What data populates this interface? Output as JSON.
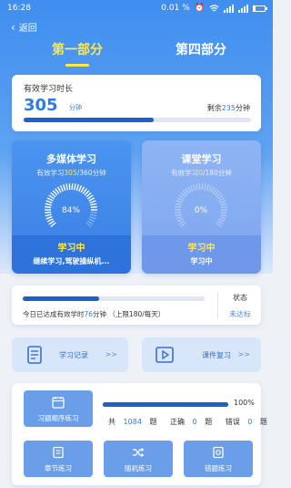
{
  "status_bar": {
    "time": "16:28",
    "data_speed": "0.01",
    "speed_unit": "%"
  },
  "nav": {
    "back_label": "返回"
  },
  "tabs": [
    {
      "label": "第一部分",
      "active": true
    },
    {
      "label": "第四部分",
      "active": false
    }
  ],
  "effective_study": {
    "title": "有效学习时长",
    "value": "305",
    "unit": "分钟",
    "remaining_prefix": "剩余",
    "remaining_value": "235",
    "remaining_unit": "分钟",
    "progress": 0.57
  },
  "multimedia": {
    "title": "多媒体学习",
    "sub_prefix": "有效学习",
    "sub_done": "305",
    "sub_total": "/360分钟",
    "percent_label": "84%",
    "percent": 84,
    "status": "学习中",
    "desc": "继续学习,驾驶操纵机..."
  },
  "classroom": {
    "title": "课堂学习",
    "sub_prefix": "有效学习",
    "sub_done": "0",
    "sub_total": "/180分钟",
    "percent_label": "0%",
    "percent": 0,
    "status": "学习中",
    "desc": "学习中"
  },
  "daily": {
    "text_prefix": "今日已达成有效学时",
    "minutes": "76",
    "text_suffix": "分钟 （上限180/每天）",
    "progress": 0.42,
    "state_label": "状态",
    "state": "未达标"
  },
  "buttons": {
    "record": {
      "label": "学习记录",
      "arrow": ">>"
    },
    "review": {
      "label": "课件复习",
      "arrow": ">>"
    }
  },
  "practice": {
    "sequential": "习题顺序练习",
    "chapter": "章节练习",
    "random": "随机练习",
    "wrong": "错题练习",
    "percent_label": "100%",
    "progress": 1.0,
    "total_prefix": "共",
    "total": "1084",
    "total_unit": "题",
    "correct_label": "正确",
    "correct": "0",
    "correct_unit": "题",
    "wrong_label": "错误",
    "wrong_count": "0",
    "wrong_unit": "题"
  },
  "colors": {
    "primary": "#2f7ae5",
    "accent_yellow": "#ffe94a",
    "progress_dark": "#1f5fc9"
  }
}
